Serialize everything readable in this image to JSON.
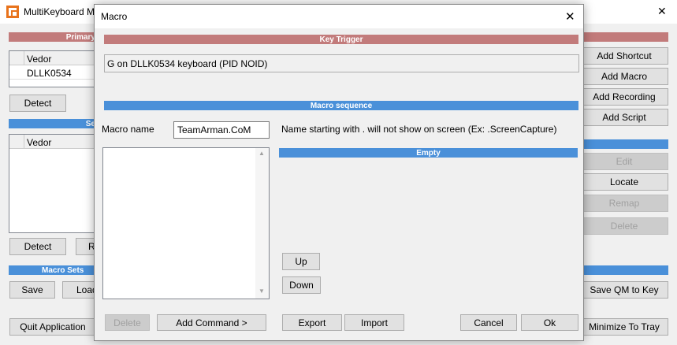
{
  "app": {
    "title": "MultiKeyboard M",
    "close_glyph": "✕",
    "primary_header": "Primary",
    "secondary_header": "Se",
    "macro_sets_header": "Macro Sets",
    "table1": {
      "col": "Vedor",
      "rows": [
        "DLLK0534"
      ]
    },
    "table2": {
      "col": "Vedor"
    },
    "buttons": {
      "detect1": "Detect",
      "detect2": "Detect",
      "r_partial": "R",
      "save": "Save",
      "load_partial": "Load",
      "quit": "Quit Application",
      "add_shortcut": "Add Shortcut",
      "add_macro": "Add Macro",
      "add_recording": "Add Recording",
      "add_script": "Add Script",
      "edit": "Edit",
      "locate": "Locate",
      "remap": "Remap",
      "delete": "Delete",
      "save_qm": "Save QM to Key",
      "minimize": "Minimize To Tray"
    }
  },
  "dialog": {
    "title": "Macro",
    "close_glyph": "✕",
    "key_trigger_header": "Key Trigger",
    "key_trigger_value": "G on DLLK0534 keyboard (PID NOID)",
    "macro_sequence_header": "Macro sequence",
    "macro_name_label": "Macro name",
    "macro_name_value": "TeamArman.CoM",
    "hint": "Name starting with . will not show on screen (Ex: .ScreenCapture)",
    "empty_header": "Empty",
    "scroll_up": "▲",
    "scroll_down": "▼",
    "buttons": {
      "up": "Up",
      "down": "Down",
      "delete": "Delete",
      "add_command": "Add Command >",
      "export": "Export",
      "import": "Import",
      "cancel": "Cancel",
      "ok": "Ok"
    }
  },
  "colors": {
    "header_red": "#c27b7b",
    "header_blue": "#4a90d9",
    "app_icon": "#e8731c"
  }
}
